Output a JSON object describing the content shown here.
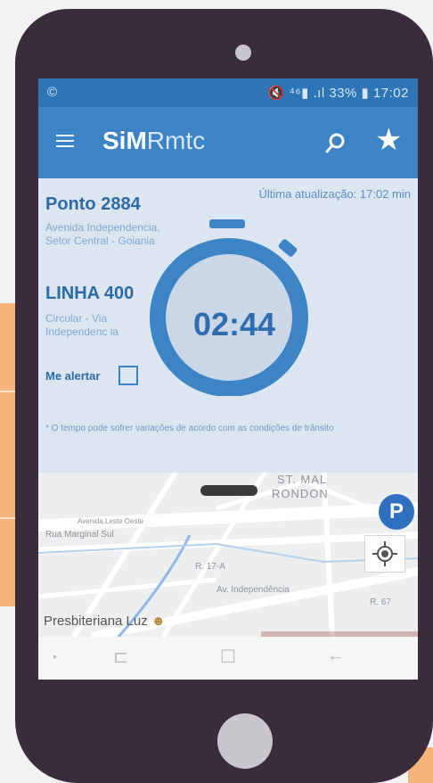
{
  "status_bar": {
    "left": "©",
    "right": "🔇 ⁴⁶▮ .ıl 33% ▮ 17:02"
  },
  "app_bar": {
    "logo_bold": "SiM",
    "logo_thin": "Rmtc"
  },
  "updated": "Última atualização: 17:02 min",
  "stop": {
    "title": "Ponto 2884",
    "address": "Avenida Independencia, Setor Central - Goiania"
  },
  "line": {
    "title": "LINHA 400",
    "route": "Circular - Via Independenc ia"
  },
  "alert_label": "Me alertar",
  "timer": "02:44",
  "note": "* O tempo pode sofrer variações de acordo com as condições de trânsito",
  "map": {
    "labels": [
      "ST. MAL",
      "RONDON",
      "Rua Marginal Sul",
      "Avenida Leste Oeste",
      "R. 17-A",
      "Av. Independência",
      "R. 67"
    ],
    "place": "Presbiteriana Luz",
    "parking": "P"
  },
  "nav": {
    "dot": "•",
    "recent": "⊏",
    "home": "☐",
    "back": "←"
  },
  "colors": {
    "primary": "#3d84c6",
    "status": "#2e75b8",
    "panel": "#dbe6f1",
    "phone": "#3a2b3d",
    "accent": "#f7b47a"
  }
}
